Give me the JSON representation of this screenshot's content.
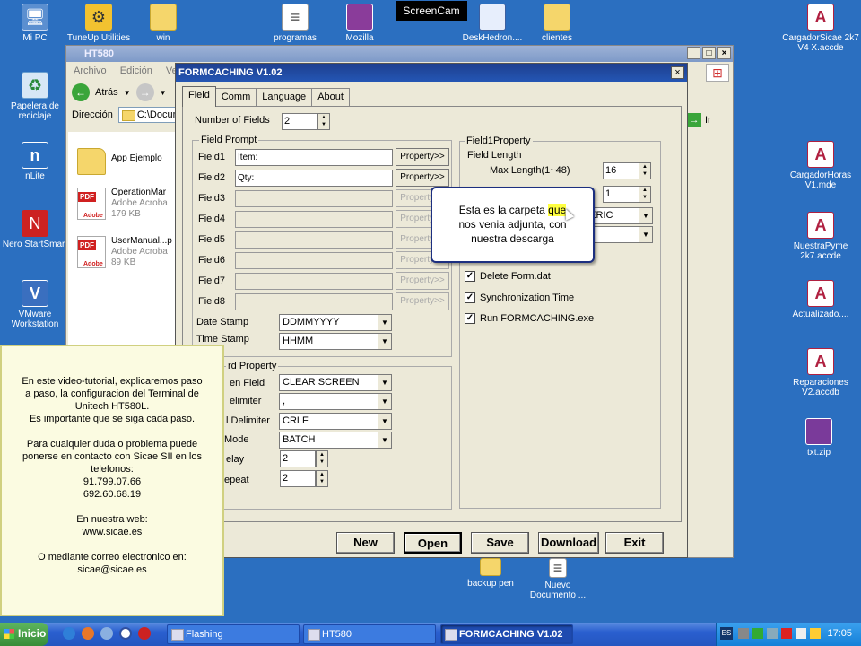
{
  "screencam_label": "ScreenCam",
  "desktop_icons": {
    "my_pc": "Mi PC",
    "tuneup": "TuneUp Utilities",
    "win": "win",
    "programas": "programas",
    "mozilla": "Mozilla",
    "deskhedron": "DeskHedron....",
    "clientes": "clientes",
    "cargador_sicae": "CargadorSicae 2k7 V4 X.accde",
    "recycle": "Papelera de reciclaje",
    "nlite": "nLite",
    "nero": "Nero StartSmart",
    "vmware": "VMware Workstation",
    "cargador_horas": "CargadorHoras V1.mde",
    "nuestra_pyme": "NuestraPyme 2k7.accde",
    "actualizado": "Actualizado....",
    "reparaciones": "Reparaciones V2.accdb",
    "txtzip": "txt.zip",
    "backup": "backup pen",
    "nuevo_doc": "Nuevo Documento ..."
  },
  "explorer": {
    "title": "HT580",
    "menu": [
      "Archivo",
      "Edición",
      "Ver"
    ],
    "back_label": "Atrás",
    "address_label": "Dirección",
    "address_value": "C:\\Docume",
    "go_label": "Ir",
    "files": [
      {
        "name": "App Ejemplo"
      },
      {
        "name": "OperationMar",
        "type": "Adobe Acroba",
        "size": "179 KB",
        "badge": "PDF",
        "brand": "Adobe"
      },
      {
        "name": "UserManual...p",
        "type": "Adobe Acroba",
        "size": "89 KB",
        "badge": "PDF",
        "brand": "Adobe"
      }
    ]
  },
  "dialog": {
    "title": "FORMCACHING V1.02",
    "close": "×",
    "tabs": [
      "Field",
      "Comm",
      "Language",
      "About"
    ],
    "num_fields_label": "Number of Fields",
    "num_fields_value": "2",
    "field_prompt_title": "Field Prompt",
    "fields": [
      {
        "label": "Field1",
        "value": "Item:"
      },
      {
        "label": "Field2",
        "value": "Qty:"
      },
      {
        "label": "Field3",
        "value": ""
      },
      {
        "label": "Field4",
        "value": ""
      },
      {
        "label": "Field5",
        "value": ""
      },
      {
        "label": "Field6",
        "value": ""
      },
      {
        "label": "Field7",
        "value": ""
      },
      {
        "label": "Field8",
        "value": ""
      }
    ],
    "property_btn": "Property>>",
    "date_stamp_label": "Date Stamp",
    "date_stamp_value": "DDMMYYYY",
    "time_stamp_label": "Time Stamp",
    "time_stamp_value": "HHMM",
    "record_title": "rd Property",
    "record_rows": [
      {
        "label": "en Field",
        "value": "CLEAR SCREEN",
        "kind": "combo"
      },
      {
        "label": "elimiter",
        "value": ",",
        "kind": "combo"
      },
      {
        "label": "l Delimiter",
        "value": "CRLF",
        "kind": "combo"
      },
      {
        "label": "Mode",
        "value": "BATCH",
        "kind": "combo"
      },
      {
        "label": "elay",
        "value": "2",
        "kind": "spin"
      },
      {
        "label": "epeat",
        "value": "2",
        "kind": "spin"
      }
    ],
    "field1_prop_title": "Field1Property",
    "field_length_label": "Field Length",
    "max_length_label": "Max Length(1~48)",
    "max_length_value": "16",
    "min_length_value": "1",
    "type_value": "MERIC",
    "checks": [
      {
        "label": "Delete Form.dat",
        "checked": true
      },
      {
        "label": "Synchronization Time",
        "checked": true
      },
      {
        "label": "Run FORMCACHING.exe",
        "checked": true
      }
    ],
    "buttons": {
      "new": "New",
      "open": "Open",
      "save": "Save",
      "download": "Download",
      "exit": "Exit"
    }
  },
  "callout": {
    "line1_pre": "Esta es la carpeta ",
    "line1_hl": "que",
    "line2": "nos venia adjunta, con",
    "line3": "nuestra descarga"
  },
  "info_panel": {
    "lines": [
      "En este video-tutorial, explicaremos paso",
      "a paso, la configuracion del Terminal de",
      "Unitech HT580L.",
      "Es importante que se siga cada paso.",
      "",
      "Para cualquier duda o problema puede",
      "ponerse en contacto con Sicae SII en los",
      "telefonos:",
      "91.799.07.66",
      "692.60.68.19",
      "",
      "En nuestra web:",
      "www.sicae.es",
      "",
      "O mediante correo electronico en:",
      "sicae@sicae.es"
    ]
  },
  "taskbar": {
    "start": "Inicio",
    "tasks": [
      "Flashing",
      "HT580",
      "FORMCACHING V1.02"
    ],
    "lang": "ES",
    "clock": "17:05"
  }
}
